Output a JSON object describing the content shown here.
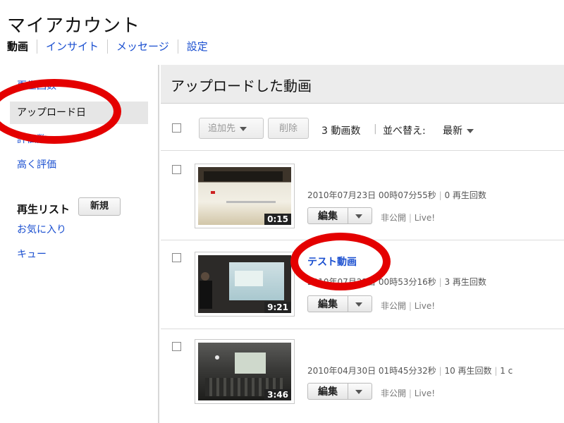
{
  "header": {
    "title": "マイアカウント",
    "tabs": [
      "動画",
      "インサイト",
      "メッセージ",
      "設定"
    ]
  },
  "sidebar": {
    "items": [
      "再生回数",
      "アップロード日",
      "評価数",
      "高く評価"
    ],
    "playlist_heading": "再生リスト",
    "new_button": "新規",
    "playlists": [
      "お気に入り",
      "キュー"
    ]
  },
  "main": {
    "title": "アップロードした動画",
    "toolbar": {
      "add_to": "追加先",
      "delete": "削除",
      "count": "3 動画数",
      "sort_label": "並べ替え:",
      "sort_value": "最新"
    },
    "videos": [
      {
        "title": "",
        "duration": "0:15",
        "date": "2010年07月23日",
        "time": "00時07分55秒",
        "views": "0 再生回数",
        "edit": "編集",
        "privacy": "非公開",
        "live": "Live!"
      },
      {
        "title": "テスト動画",
        "duration": "9:21",
        "date": "2010年07月22日",
        "time": "00時53分16秒",
        "views": "3 再生回数",
        "edit": "編集",
        "privacy": "非公開",
        "live": "Live!"
      },
      {
        "title": "",
        "duration": "3:46",
        "date": "2010年04月30日",
        "time": "01時45分32秒",
        "views": "10 再生回数",
        "extra": "1 c",
        "edit": "編集",
        "privacy": "非公開",
        "live": "Live!"
      }
    ]
  },
  "colors": {
    "link": "#1a4fd0",
    "highlight": "#e40000",
    "selected_bg": "#e6e6e6"
  }
}
